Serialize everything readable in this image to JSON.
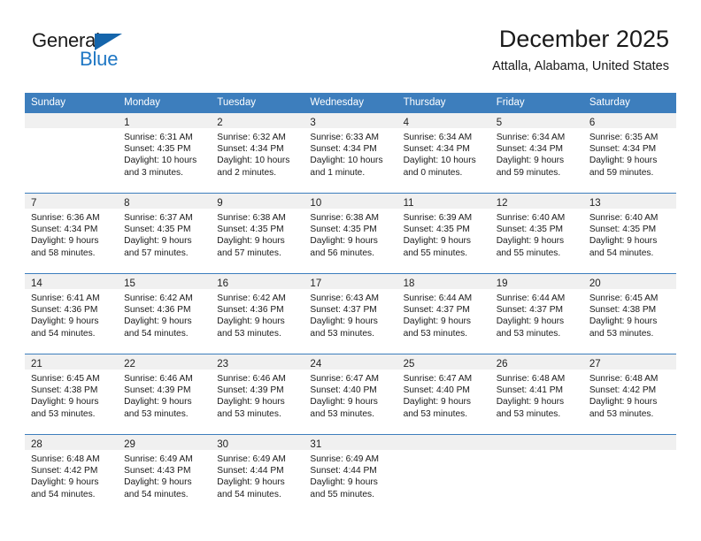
{
  "brand": {
    "name_part1": "General",
    "name_part2": "Blue"
  },
  "header": {
    "title": "December 2025",
    "subtitle": "Attalla, Alabama, United States"
  },
  "colors": {
    "header_blue": "#3d7ebd",
    "brand_blue": "#1f77c4",
    "daynum_band": "#f0f0f0"
  },
  "weekday_headers": [
    "Sunday",
    "Monday",
    "Tuesday",
    "Wednesday",
    "Thursday",
    "Friday",
    "Saturday"
  ],
  "weeks": [
    [
      {
        "day": "",
        "lines": []
      },
      {
        "day": "1",
        "lines": [
          "Sunrise: 6:31 AM",
          "Sunset: 4:35 PM",
          "Daylight: 10 hours",
          "and 3 minutes."
        ]
      },
      {
        "day": "2",
        "lines": [
          "Sunrise: 6:32 AM",
          "Sunset: 4:34 PM",
          "Daylight: 10 hours",
          "and 2 minutes."
        ]
      },
      {
        "day": "3",
        "lines": [
          "Sunrise: 6:33 AM",
          "Sunset: 4:34 PM",
          "Daylight: 10 hours",
          "and 1 minute."
        ]
      },
      {
        "day": "4",
        "lines": [
          "Sunrise: 6:34 AM",
          "Sunset: 4:34 PM",
          "Daylight: 10 hours",
          "and 0 minutes."
        ]
      },
      {
        "day": "5",
        "lines": [
          "Sunrise: 6:34 AM",
          "Sunset: 4:34 PM",
          "Daylight: 9 hours",
          "and 59 minutes."
        ]
      },
      {
        "day": "6",
        "lines": [
          "Sunrise: 6:35 AM",
          "Sunset: 4:34 PM",
          "Daylight: 9 hours",
          "and 59 minutes."
        ]
      }
    ],
    [
      {
        "day": "7",
        "lines": [
          "Sunrise: 6:36 AM",
          "Sunset: 4:34 PM",
          "Daylight: 9 hours",
          "and 58 minutes."
        ]
      },
      {
        "day": "8",
        "lines": [
          "Sunrise: 6:37 AM",
          "Sunset: 4:35 PM",
          "Daylight: 9 hours",
          "and 57 minutes."
        ]
      },
      {
        "day": "9",
        "lines": [
          "Sunrise: 6:38 AM",
          "Sunset: 4:35 PM",
          "Daylight: 9 hours",
          "and 57 minutes."
        ]
      },
      {
        "day": "10",
        "lines": [
          "Sunrise: 6:38 AM",
          "Sunset: 4:35 PM",
          "Daylight: 9 hours",
          "and 56 minutes."
        ]
      },
      {
        "day": "11",
        "lines": [
          "Sunrise: 6:39 AM",
          "Sunset: 4:35 PM",
          "Daylight: 9 hours",
          "and 55 minutes."
        ]
      },
      {
        "day": "12",
        "lines": [
          "Sunrise: 6:40 AM",
          "Sunset: 4:35 PM",
          "Daylight: 9 hours",
          "and 55 minutes."
        ]
      },
      {
        "day": "13",
        "lines": [
          "Sunrise: 6:40 AM",
          "Sunset: 4:35 PM",
          "Daylight: 9 hours",
          "and 54 minutes."
        ]
      }
    ],
    [
      {
        "day": "14",
        "lines": [
          "Sunrise: 6:41 AM",
          "Sunset: 4:36 PM",
          "Daylight: 9 hours",
          "and 54 minutes."
        ]
      },
      {
        "day": "15",
        "lines": [
          "Sunrise: 6:42 AM",
          "Sunset: 4:36 PM",
          "Daylight: 9 hours",
          "and 54 minutes."
        ]
      },
      {
        "day": "16",
        "lines": [
          "Sunrise: 6:42 AM",
          "Sunset: 4:36 PM",
          "Daylight: 9 hours",
          "and 53 minutes."
        ]
      },
      {
        "day": "17",
        "lines": [
          "Sunrise: 6:43 AM",
          "Sunset: 4:37 PM",
          "Daylight: 9 hours",
          "and 53 minutes."
        ]
      },
      {
        "day": "18",
        "lines": [
          "Sunrise: 6:44 AM",
          "Sunset: 4:37 PM",
          "Daylight: 9 hours",
          "and 53 minutes."
        ]
      },
      {
        "day": "19",
        "lines": [
          "Sunrise: 6:44 AM",
          "Sunset: 4:37 PM",
          "Daylight: 9 hours",
          "and 53 minutes."
        ]
      },
      {
        "day": "20",
        "lines": [
          "Sunrise: 6:45 AM",
          "Sunset: 4:38 PM",
          "Daylight: 9 hours",
          "and 53 minutes."
        ]
      }
    ],
    [
      {
        "day": "21",
        "lines": [
          "Sunrise: 6:45 AM",
          "Sunset: 4:38 PM",
          "Daylight: 9 hours",
          "and 53 minutes."
        ]
      },
      {
        "day": "22",
        "lines": [
          "Sunrise: 6:46 AM",
          "Sunset: 4:39 PM",
          "Daylight: 9 hours",
          "and 53 minutes."
        ]
      },
      {
        "day": "23",
        "lines": [
          "Sunrise: 6:46 AM",
          "Sunset: 4:39 PM",
          "Daylight: 9 hours",
          "and 53 minutes."
        ]
      },
      {
        "day": "24",
        "lines": [
          "Sunrise: 6:47 AM",
          "Sunset: 4:40 PM",
          "Daylight: 9 hours",
          "and 53 minutes."
        ]
      },
      {
        "day": "25",
        "lines": [
          "Sunrise: 6:47 AM",
          "Sunset: 4:40 PM",
          "Daylight: 9 hours",
          "and 53 minutes."
        ]
      },
      {
        "day": "26",
        "lines": [
          "Sunrise: 6:48 AM",
          "Sunset: 4:41 PM",
          "Daylight: 9 hours",
          "and 53 minutes."
        ]
      },
      {
        "day": "27",
        "lines": [
          "Sunrise: 6:48 AM",
          "Sunset: 4:42 PM",
          "Daylight: 9 hours",
          "and 53 minutes."
        ]
      }
    ],
    [
      {
        "day": "28",
        "lines": [
          "Sunrise: 6:48 AM",
          "Sunset: 4:42 PM",
          "Daylight: 9 hours",
          "and 54 minutes."
        ]
      },
      {
        "day": "29",
        "lines": [
          "Sunrise: 6:49 AM",
          "Sunset: 4:43 PM",
          "Daylight: 9 hours",
          "and 54 minutes."
        ]
      },
      {
        "day": "30",
        "lines": [
          "Sunrise: 6:49 AM",
          "Sunset: 4:44 PM",
          "Daylight: 9 hours",
          "and 54 minutes."
        ]
      },
      {
        "day": "31",
        "lines": [
          "Sunrise: 6:49 AM",
          "Sunset: 4:44 PM",
          "Daylight: 9 hours",
          "and 55 minutes."
        ]
      },
      {
        "day": "",
        "lines": []
      },
      {
        "day": "",
        "lines": []
      },
      {
        "day": "",
        "lines": []
      }
    ]
  ]
}
